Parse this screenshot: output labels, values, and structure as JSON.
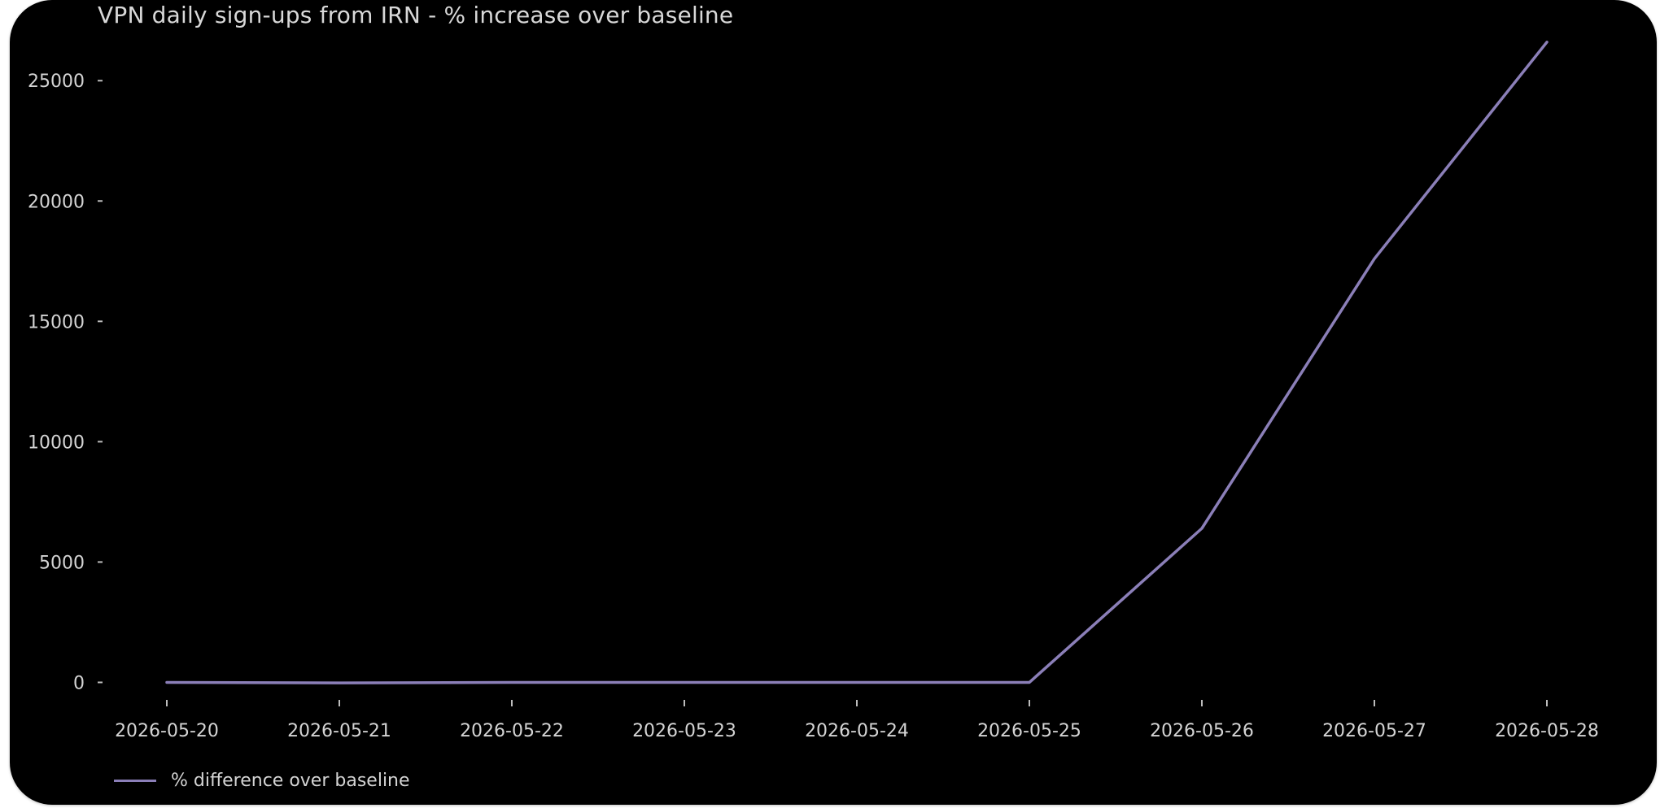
{
  "chart_data": {
    "type": "line",
    "title": "VPN daily sign-ups from IRN - % increase over baseline",
    "xlabel": "",
    "ylabel": "",
    "x_ticks": [
      "2026-05-20",
      "2026-05-21",
      "2026-05-22",
      "2026-05-23",
      "2026-05-24",
      "2026-05-25",
      "2026-05-26",
      "2026-05-27",
      "2026-05-28"
    ],
    "y_ticks": [
      0,
      5000,
      10000,
      15000,
      20000,
      25000
    ],
    "ylim": [
      -1200,
      27000
    ],
    "xlim": [
      "2026-05-19T18:00",
      "2026-05-28T12:00"
    ],
    "grid": false,
    "legend_position": "bottom-left",
    "series": [
      {
        "name": "% difference over baseline",
        "color": "#8b7fb8",
        "points": [
          {
            "x": "2026-05-20",
            "y": 0
          },
          {
            "x": "2026-05-21",
            "y": -20
          },
          {
            "x": "2026-05-22",
            "y": 0
          },
          {
            "x": "2026-05-23",
            "y": 0
          },
          {
            "x": "2026-05-24",
            "y": 0
          },
          {
            "x": "2026-05-25",
            "y": 0
          },
          {
            "x": "2026-05-26",
            "y": 6400
          },
          {
            "x": "2026-05-27",
            "y": 17600
          },
          {
            "x": "2026-05-28",
            "y": 26600
          }
        ]
      }
    ]
  },
  "colors": {
    "background": "#000000",
    "text": "#d4d4d4",
    "series_line": "#8b7fb8"
  }
}
